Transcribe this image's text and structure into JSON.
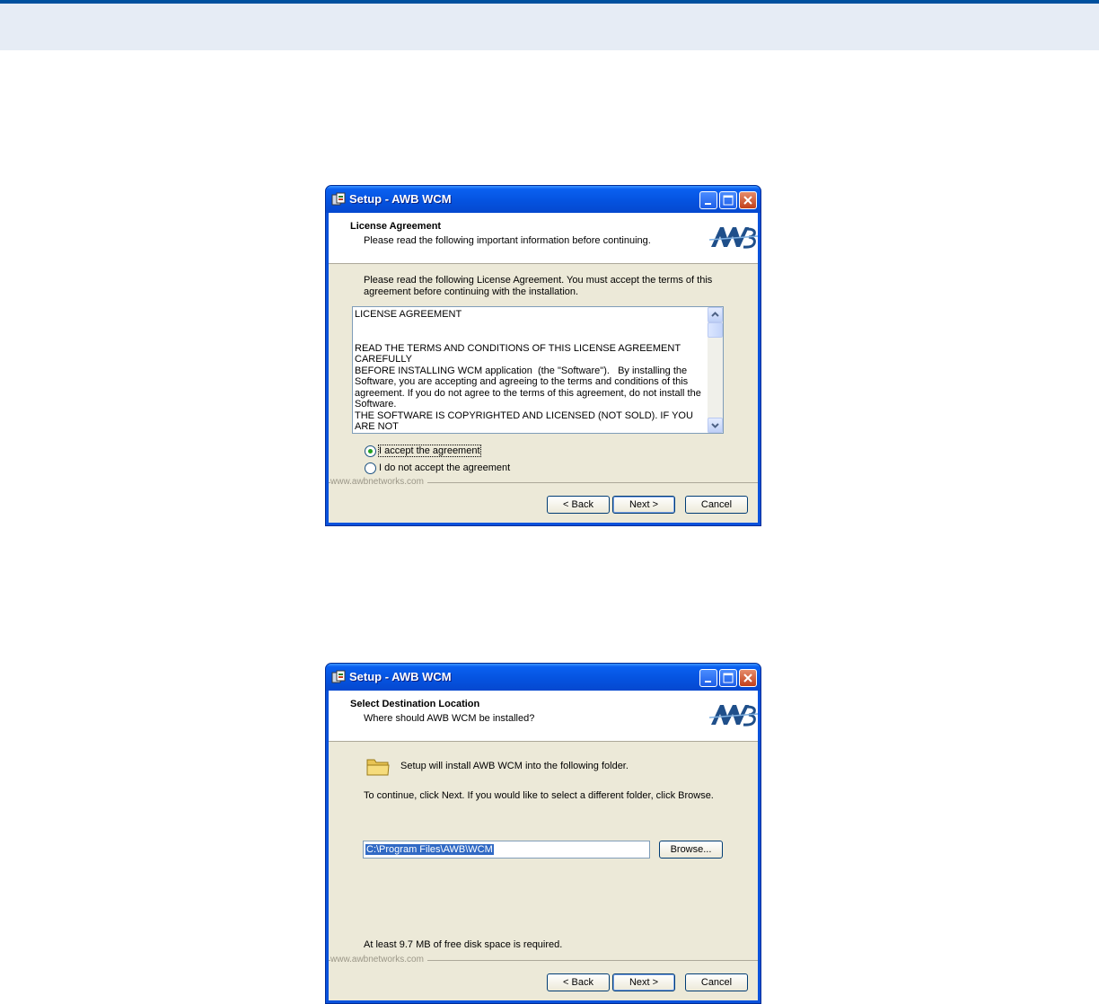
{
  "colors": {
    "header_band": "#e6ecf5",
    "header_rule": "#00509e",
    "xp_title_blue": "#0553e0",
    "dialog_face": "#ece9d8",
    "selection": "#316ac5"
  },
  "dialogs": [
    {
      "window_title": "Setup - AWB WCM",
      "header_title": "License Agreement",
      "header_subtitle": "Please read the following important information before continuing.",
      "logo": "awb-logo-icon",
      "intro_line1": "Please read the following License Agreement. You must accept the terms of this",
      "intro_line2": "agreement before continuing with the installation.",
      "license_text": "LICENSE AGREEMENT\n\n\nREAD THE TERMS AND CONDITIONS OF THIS LICENSE AGREEMENT CAREFULLY\nBEFORE INSTALLING WCM application  (the \"Software\").   By installing the\nSoftware, you are accepting and agreeing to the terms and conditions of this\nagreement. If you do not agree to the terms of this agreement, do not install the\nSoftware.\nTHE SOFTWARE IS COPYRIGHTED AND LICENSED (NOT SOLD). IF YOU ARE NOT\nWILLING TO BE BOUND BY THE TERMS OF THIS LICENSE AGREEMENT, YOU\nSHOLLD PROMPTLY QUIT THE INSTALLATION.  THIS LICENSE AGREEMENT",
      "radio_accept": "I accept the agreement",
      "radio_decline": "I do not accept the agreement",
      "accept_selected": true,
      "footer_link": "www.awbnetworks.com",
      "back_label": "< Back",
      "next_label": "Next >",
      "cancel_label": "Cancel"
    },
    {
      "window_title": "Setup - AWB WCM",
      "header_title": "Select Destination Location",
      "header_subtitle": "Where should AWB WCM be installed?",
      "logo": "awb-logo-icon",
      "folder_text": "Setup will install AWB WCM into the following folder.",
      "continue_text": "To continue, click Next. If you would like to select a different folder, click Browse.",
      "install_path": "C:\\Program Files\\AWB\\WCM",
      "browse_label": "Browse...",
      "disk_space_text": "At least 9.7 MB of free disk space is required.",
      "footer_link": "www.awbnetworks.com",
      "back_label": "< Back",
      "next_label": "Next >",
      "cancel_label": "Cancel"
    }
  ]
}
